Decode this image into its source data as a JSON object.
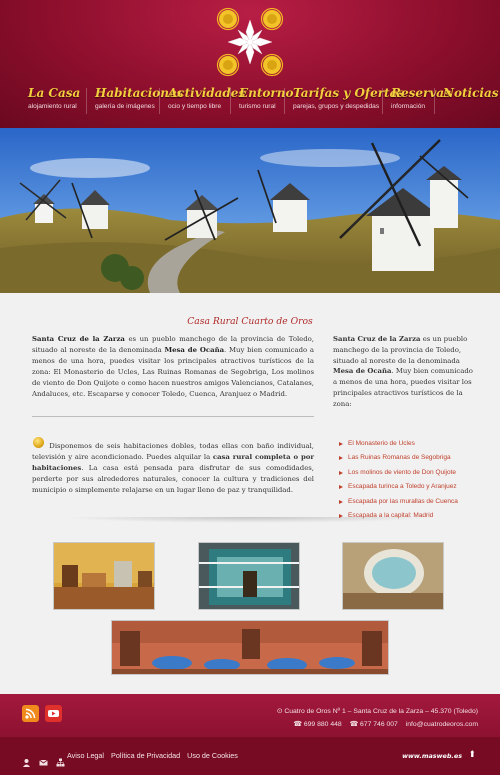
{
  "nav": [
    {
      "title": "La Casa",
      "sub": "alojamiento rural"
    },
    {
      "title": "Habitaciones",
      "sub": "galería de imágenes"
    },
    {
      "title": "Actividades",
      "sub": "ocio y tiempo libre"
    },
    {
      "title": "Entorno",
      "sub": "turismo rural"
    },
    {
      "title": "Tarifas y Ofertas",
      "sub": "parejas, grupos y despedidas"
    },
    {
      "title": "Reservas",
      "sub": "información"
    },
    {
      "title": "Noticias",
      "sub": ""
    }
  ],
  "content": {
    "title": "Casa Rural Cuarto de Oros",
    "intro_bold1": "Santa Cruz de la Zarza",
    "intro_text1": " es un pueblo manchego de la provincia de Toledo, situado al noreste de la denominada ",
    "intro_bold2": "Mesa de Ocaña",
    "intro_text2": ". Muy bien comunicado a menos de una hora, puedes visitar los principales atractivos turísticos de la zona: El Monasterio de Ucles, Las Ruinas Romanas de Segobriga, Los molinos de viento de Don Quijote o como hacen nuestros amigos Valencianos, Catalanes, Andaluces, etc. Escaparse y conocer Toledo, Cuenca, Aranjuez o Madrid.",
    "rooms_text1": " Disponemos de seis habitaciones dobles, todas ellas con baño individual, televisión y aire acondicionado. Puedes alquilar la ",
    "rooms_bold": "casa rural completa o por habitaciones",
    "rooms_text2": ". La casa está pensada para disfrutar de sus comodidades, perderte por sus alrededores naturales, conocer la cultura y tradiciones del municipio o simplemente relajarse en un lugar lleno de paz y tranquilidad.",
    "right_bold1": "Santa Cruz de la Zarza",
    "right_text1": " es un pueblo manchego de la provincia de Toledo, situado al noreste de la denominada ",
    "right_bold2": "Mesa de Ocaña",
    "right_text2": ". Muy bien comunicado a menos de una hora, puedes visitar los principales atractivos turísticos de la zona:",
    "links": [
      "El Monasterio de Ucles",
      "Las Ruinas Romanas de Segobriga",
      "Los molinos de viento de Don Quijote",
      "Escapada turinca a Toledo y Aranjuez",
      "Escapada por las murallas de Cuenca",
      "Escapada a la capital: Madrid"
    ]
  },
  "footer": {
    "address": "Cuatro de Oros Nº 1 – Santa Cruz de la Zarza – 45.370 (Toledo)",
    "phone1": "699 880 448",
    "phone2": "677 746 007",
    "email": "info@cuatrodeoros.com",
    "links": [
      "Aviso Legal",
      "Política de Privacidad",
      "Uso de Cookies"
    ],
    "credit": "www.masweb.es"
  },
  "colors": {
    "header": "#8e0f2d",
    "nav_text": "#f3cf3e",
    "link": "#c0402c",
    "footer": "#7e0e27"
  }
}
